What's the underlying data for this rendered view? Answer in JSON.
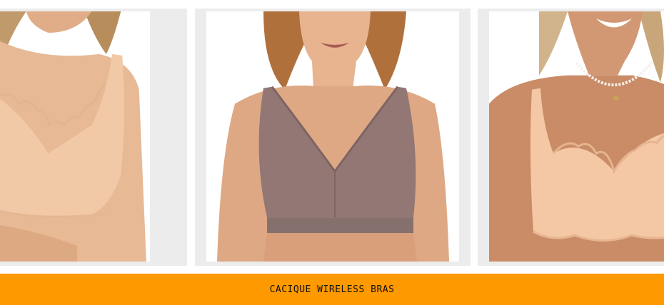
{
  "banner": {
    "label": "CACIQUE WIRELESS BRAS",
    "background": "#ff9900",
    "text_color": "#111111"
  },
  "products": [
    {
      "name": "product-photo-nude-scalloped-bra",
      "bra_color": "#f2c9a6"
    },
    {
      "name": "product-photo-mauve-v-neck-bra",
      "bra_color": "#927775"
    },
    {
      "name": "product-photo-nude-scalloped-bra-pearls",
      "bra_color": "#f4c7a5"
    }
  ]
}
